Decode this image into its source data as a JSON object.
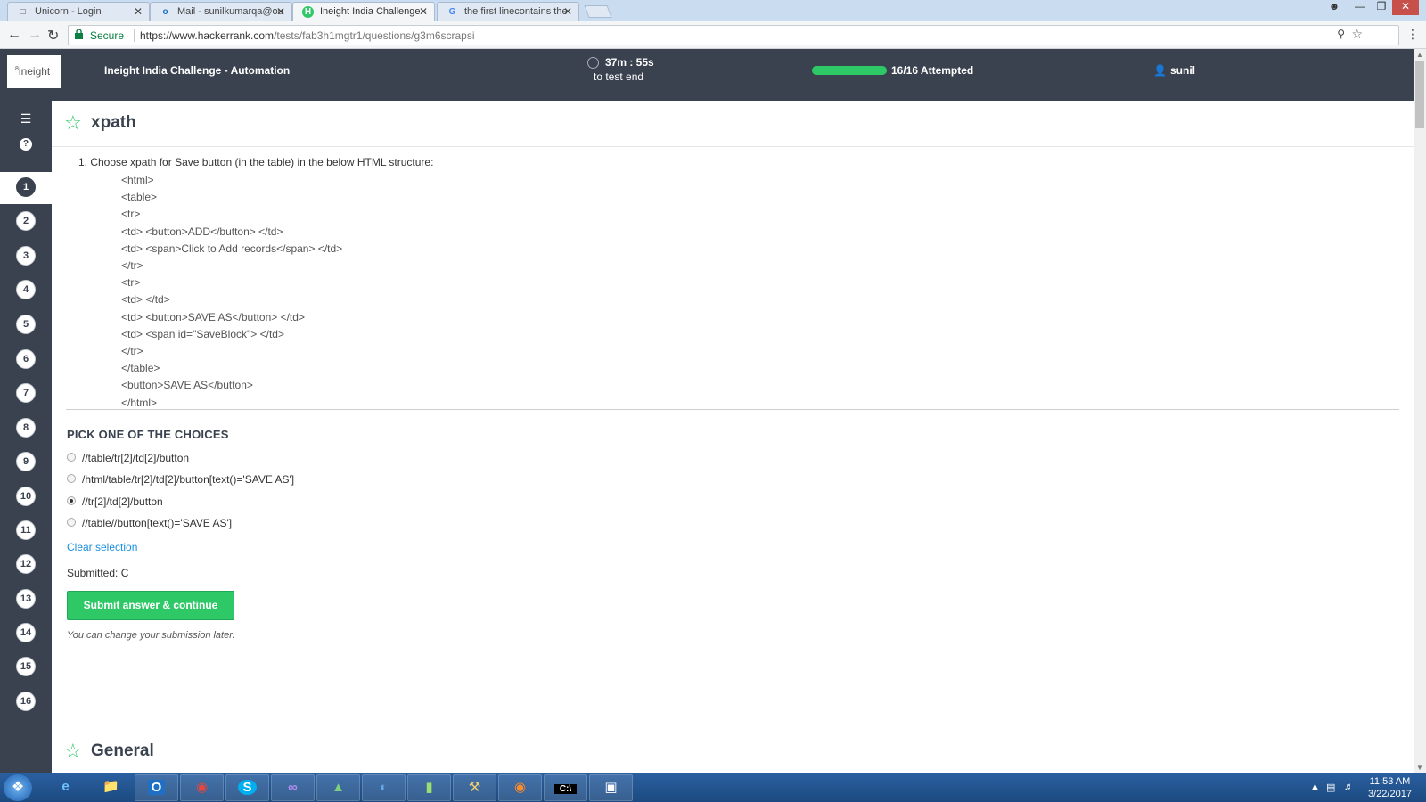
{
  "browser": {
    "tabs": [
      {
        "title": "Unicorn - Login",
        "icon": "page-icon"
      },
      {
        "title": "Mail - sunilkumarqa@ou",
        "icon": "outlook-icon"
      },
      {
        "title": "Ineight India Challenge -",
        "icon": "hackerrank-icon"
      },
      {
        "title": "the first linecontains the",
        "icon": "google-icon"
      }
    ],
    "secure_label": "Secure",
    "url_host": "https://www.hackerrank.com",
    "url_path": "/tests/fab3h1mgtr1/questions/g3m6scrapsi"
  },
  "header": {
    "logo_text": "ineight",
    "test_title": "Ineight India Challenge - Automation",
    "timer": "37m : 55s",
    "timer_sub": "to test end",
    "progress_fraction": 1.0,
    "attempted": "16/16 Attempted",
    "user": "sunil"
  },
  "sidebar": {
    "menu_icon": "list-icon",
    "help_label": "?",
    "questions": [
      "1",
      "2",
      "3",
      "4",
      "5",
      "6",
      "7",
      "8",
      "9",
      "10",
      "11",
      "12",
      "13",
      "14",
      "15",
      "16"
    ],
    "current": "1"
  },
  "question": {
    "title": "xpath",
    "text": "1. Choose xpath for Save button (in the table) in the below HTML structure:",
    "code_lines": [
      "<html>",
      "<table>",
      "<tr>",
      "<td> <button>ADD</button> </td>",
      "<td> <span>Click to Add records</span> </td>",
      "</tr>",
      "<tr>",
      "<td> </td>",
      "<td> <button>SAVE AS</button> </td>",
      "<td> <span id=\"SaveBlock\"> </td>",
      "</tr>",
      "</table>",
      "<button>SAVE AS</button>",
      "</html>"
    ],
    "pick_label": "PICK ONE OF THE CHOICES",
    "choices": [
      {
        "text": "//table/tr[2]/td[2]/button",
        "checked": false
      },
      {
        "text": "/html/table/tr[2]/td[2]/button[text()='SAVE AS']",
        "checked": false
      },
      {
        "text": "//tr[2]/td[2]/button",
        "checked": true
      },
      {
        "text": "//table//button[text()='SAVE AS']",
        "checked": false
      }
    ],
    "clear_label": "Clear selection",
    "submitted": "Submitted: C",
    "submit_label": "Submit answer & continue",
    "note": "You can change your submission later."
  },
  "next_section": {
    "title": "General"
  },
  "taskbar": {
    "clock_time": "11:53 AM",
    "clock_date": "3/22/2017"
  },
  "colors": {
    "header_bg": "#39424e",
    "accent_green": "#2ec866",
    "link_blue": "#1a8fe0"
  }
}
